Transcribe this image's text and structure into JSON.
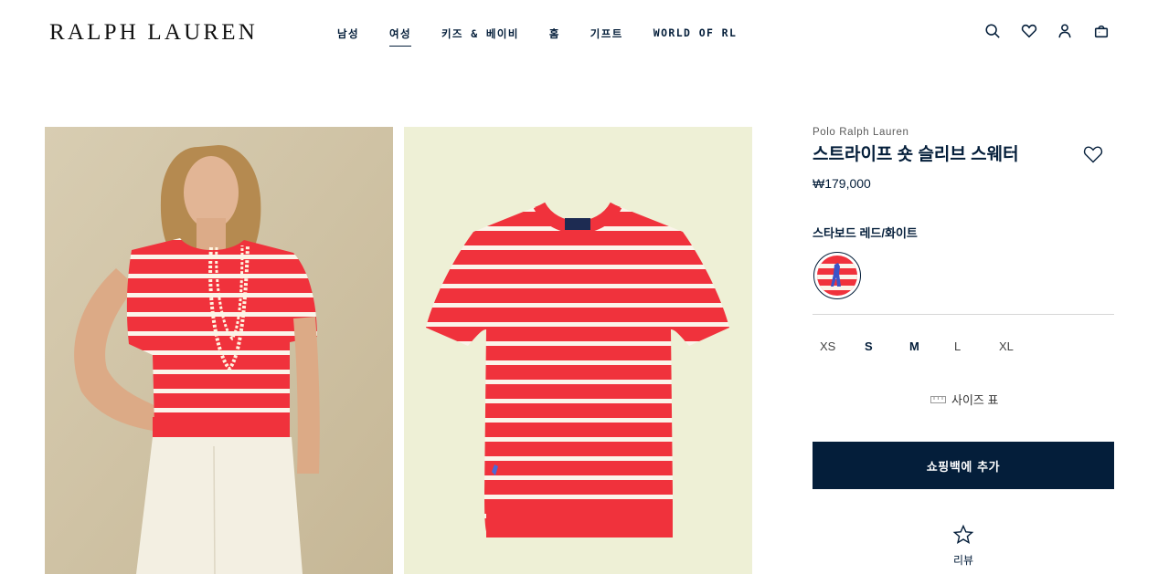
{
  "header": {
    "logo": "RALPH LAUREN",
    "nav": [
      "남성",
      "여성",
      "키즈 & 베이비",
      "홈",
      "기프트",
      "WORLD OF RL"
    ],
    "active_nav": "여성",
    "utilities": [
      "search-icon",
      "heart-icon",
      "account-icon",
      "bag-icon"
    ]
  },
  "gallery": {
    "images": [
      "model wearing striped sweater",
      "striped sweater flat lay"
    ]
  },
  "product": {
    "brand": "Polo Ralph Lauren",
    "title": "스트라이프 숏 슬리브 스웨터",
    "price": "₩179,000",
    "color_name": "스타보드 레드/화이트",
    "sizes": [
      "XS",
      "S",
      "M",
      "L",
      "XL"
    ],
    "available_sizes": [
      "S",
      "M"
    ],
    "size_chart_label": "사이즈 표",
    "add_to_bag_label": "쇼핑백에 추가",
    "review_label": "리뷰"
  },
  "colors": {
    "navy": "#041e3a",
    "stripe_red": "#f0323c",
    "stripe_white": "#fbf4ea"
  }
}
